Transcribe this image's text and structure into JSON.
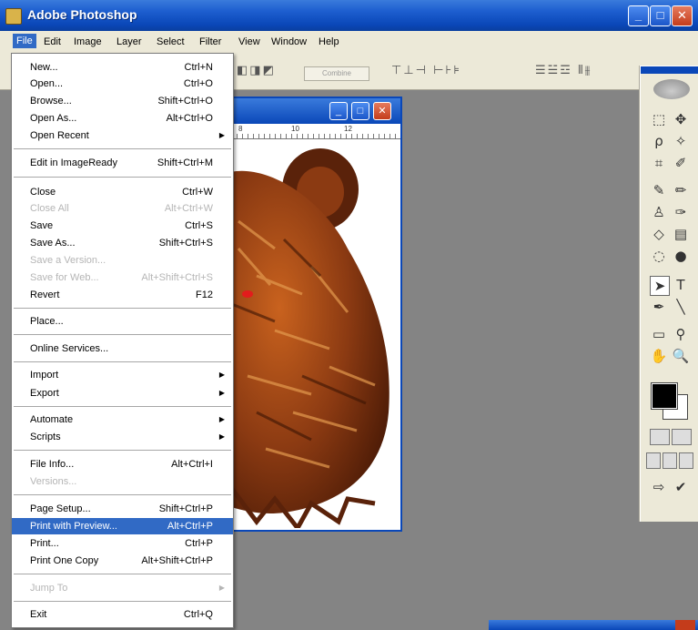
{
  "window": {
    "title": "Adobe Photoshop",
    "buttons": {
      "minimize": "_",
      "maximize": "□",
      "close": "✕"
    }
  },
  "menubar": {
    "items": [
      "File",
      "Edit",
      "Image",
      "Layer",
      "Select",
      "Filter",
      "View",
      "Window",
      "Help"
    ]
  },
  "options_bar": {
    "commit_label": "Combine"
  },
  "document": {
    "ruler_labels": [
      "8",
      "10",
      "12"
    ]
  },
  "file_menu": {
    "items": [
      {
        "label": "New...",
        "shortcut": "Ctrl+N"
      },
      {
        "label": "Open...",
        "shortcut": "Ctrl+O"
      },
      {
        "label": "Browse...",
        "shortcut": "Shift+Ctrl+O"
      },
      {
        "label": "Open As...",
        "shortcut": "Alt+Ctrl+O"
      },
      {
        "label": "Open Recent",
        "shortcut": "",
        "submenu": true
      },
      {
        "label": "Edit in ImageReady",
        "shortcut": "Shift+Ctrl+M"
      },
      {
        "label": "Close",
        "shortcut": "Ctrl+W"
      },
      {
        "label": "Close All",
        "shortcut": "Alt+Ctrl+W",
        "disabled": true
      },
      {
        "label": "Save",
        "shortcut": "Ctrl+S"
      },
      {
        "label": "Save As...",
        "shortcut": "Shift+Ctrl+S"
      },
      {
        "label": "Save a Version...",
        "shortcut": "",
        "disabled": true
      },
      {
        "label": "Save for Web...",
        "shortcut": "Alt+Shift+Ctrl+S",
        "disabled": true
      },
      {
        "label": "Revert",
        "shortcut": "F12"
      },
      {
        "label": "Place...",
        "shortcut": ""
      },
      {
        "label": "Online Services...",
        "shortcut": ""
      },
      {
        "label": "Import",
        "shortcut": "",
        "submenu": true
      },
      {
        "label": "Export",
        "shortcut": "",
        "submenu": true
      },
      {
        "label": "Automate",
        "shortcut": "",
        "submenu": true
      },
      {
        "label": "Scripts",
        "shortcut": "",
        "submenu": true
      },
      {
        "label": "File Info...",
        "shortcut": "Alt+Ctrl+I"
      },
      {
        "label": "Versions...",
        "shortcut": "",
        "disabled": true
      },
      {
        "label": "Page Setup...",
        "shortcut": "Shift+Ctrl+P"
      },
      {
        "label": "Print with Preview...",
        "shortcut": "Alt+Ctrl+P",
        "highlighted": true
      },
      {
        "label": "Print...",
        "shortcut": "Ctrl+P"
      },
      {
        "label": "Print One Copy",
        "shortcut": "Alt+Shift+Ctrl+P"
      },
      {
        "label": "Jump To",
        "shortcut": "",
        "submenu": true,
        "disabled": true
      },
      {
        "label": "Exit",
        "shortcut": "Ctrl+Q"
      }
    ]
  },
  "toolbox": {
    "foreground_color": "#000000",
    "background_color": "#ffffff"
  },
  "colors": {
    "titlebar": "#0a47b8",
    "highlight": "#316ac5",
    "menu_bg": "#ece9d8",
    "workspace": "#848484",
    "bear_fur": "#8b3a12"
  }
}
